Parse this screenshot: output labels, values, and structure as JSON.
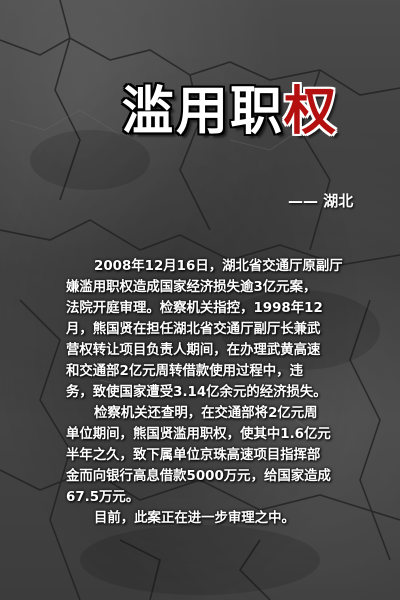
{
  "title": {
    "part1": "滥用职",
    "part2": "权"
  },
  "subtitle": "——  湖北",
  "article": {
    "lines": [
      "2008年12月16日，湖北省交通厅原副厅",
      "嫌滥用职权造成国家经济损失逾3亿元案，",
      "法院开庭审理。检察机关指控，1998年12",
      "月，熊国贤在担任湖北省交通厅副厅长兼武",
      "营权转让项目负责人期间，在办理武黄高速",
      "和交通部2亿元周转借款使用过程中，违",
      "务，致使国家遭受3.14亿余元的经济损失。",
      "检察机关还查明，在交通部将2亿元周",
      "单位期间，熊国贤滥用职权，使其中1.6亿元",
      "半年之久，致下属单位京珠高速项目指挥部",
      "金而向银行高息借款5000万元，给国家造成",
      "67.5万元。",
      "目前，此案正在进一步审理之中。"
    ]
  }
}
